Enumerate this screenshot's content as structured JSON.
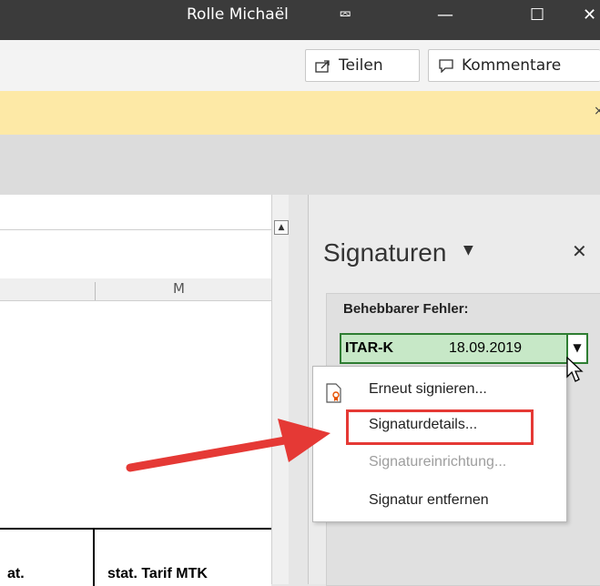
{
  "titlebar": {
    "user": "Rolle Michaël",
    "buttons": [
      "⮹",
      "—",
      "☐",
      "✕"
    ]
  },
  "ribbon": {
    "share_label": "Teilen",
    "comments_label": "Kommentare"
  },
  "notice": {
    "close": "×"
  },
  "sheet": {
    "column_header": "M",
    "cells": [
      "at.",
      "stat. Tarif MTK"
    ]
  },
  "pane": {
    "title": "Signaturen",
    "section_header": "Behebbarer Fehler:",
    "signature": {
      "name": "ITAR-K",
      "date": "18.09.2019"
    },
    "menu": {
      "items": [
        {
          "label": "Erneut signieren...",
          "enabled": true
        },
        {
          "label": "Signaturdetails...",
          "enabled": true,
          "highlighted": true
        },
        {
          "label": "Signatureinrichtung...",
          "enabled": false
        },
        {
          "label": "Signatur entfernen",
          "enabled": true
        }
      ]
    }
  },
  "colors": {
    "highlight_border": "#e53935",
    "arrow": "#e53935",
    "signature_bg": "#c7e8c7",
    "signature_border": "#2e7d32",
    "notice_bg": "#fde9a6"
  }
}
